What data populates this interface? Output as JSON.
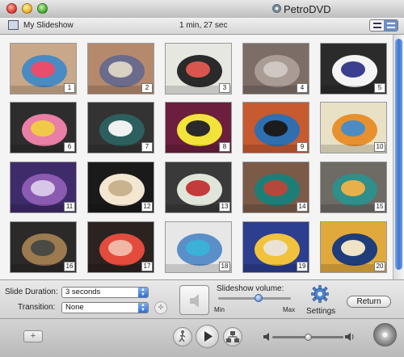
{
  "window": {
    "app_title": "PetroDVD"
  },
  "toolbar": {
    "slideshow_title": "My Slideshow",
    "duration": "1 min, 27 sec"
  },
  "thumbnails": [
    {
      "number": "1",
      "colors": [
        "#c9a88a",
        "#4a8bc1",
        "#e94d6b"
      ]
    },
    {
      "number": "2",
      "colors": [
        "#b58a6c",
        "#6b6b8c",
        "#d8d1c4"
      ]
    },
    {
      "number": "3",
      "colors": [
        "#e7e7e2",
        "#2a2a2a",
        "#d9564f"
      ]
    },
    {
      "number": "4",
      "colors": [
        "#7c6d66",
        "#a99c94",
        "#cfc7c2"
      ]
    },
    {
      "number": "5",
      "colors": [
        "#2b2b2b",
        "#f4f4f4",
        "#3b3f8e"
      ]
    },
    {
      "number": "6",
      "colors": [
        "#2d2d2d",
        "#e97ea6",
        "#f1c948"
      ]
    },
    {
      "number": "7",
      "colors": [
        "#333333",
        "#2d5f5f",
        "#f1f1f1"
      ]
    },
    {
      "number": "8",
      "colors": [
        "#6b1e3e",
        "#f2e33a",
        "#2a2a2a"
      ]
    },
    {
      "number": "9",
      "colors": [
        "#c75a2f",
        "#2f6fb0",
        "#1c1c1c"
      ]
    },
    {
      "number": "10",
      "colors": [
        "#e9e1c6",
        "#e8902d",
        "#4c8cc3"
      ]
    },
    {
      "number": "11",
      "colors": [
        "#3e2b6a",
        "#8a5bb1",
        "#d8c6e8"
      ]
    },
    {
      "number": "12",
      "colors": [
        "#1a1a1a",
        "#f3e7d2",
        "#c9b28e"
      ]
    },
    {
      "number": "13",
      "colors": [
        "#3a3a3a",
        "#dfe6d9",
        "#c33b3b"
      ]
    },
    {
      "number": "14",
      "colors": [
        "#7b5a47",
        "#1c7f77",
        "#b4483b"
      ]
    },
    {
      "number": "15",
      "colors": [
        "#6e6a64",
        "#2f8f8a",
        "#e8b04a"
      ]
    },
    {
      "number": "16",
      "colors": [
        "#2c2a28",
        "#9b7a4f",
        "#4a4a45"
      ]
    },
    {
      "number": "17",
      "colors": [
        "#2b2320",
        "#e34b3d",
        "#f1b6a6"
      ]
    },
    {
      "number": "18",
      "colors": [
        "#e7e7e7",
        "#5a8fc9",
        "#3ab1d6"
      ]
    },
    {
      "number": "19",
      "colors": [
        "#2c3e8f",
        "#f2c23c",
        "#e8e3d4"
      ]
    },
    {
      "number": "20",
      "colors": [
        "#e1a93c",
        "#1f3d7a",
        "#efe3c8"
      ]
    }
  ],
  "controls": {
    "slide_duration_label": "Slide Duration:",
    "slide_duration_value": "3 seconds",
    "transition_label": "Transition:",
    "transition_value": "None",
    "volume_label": "Slideshow volume:",
    "volume_min": "Min",
    "volume_max": "Max",
    "volume_level": 0.55,
    "settings_label": "Settings",
    "return_label": "Return"
  },
  "bottom": {
    "add_label": "+",
    "playback_volume_level": 0.5
  },
  "icons": {
    "app": "dvd-disc-icon",
    "slideshow": "slideshow-icon",
    "speaker": "speaker-icon",
    "settings": "gear-icon",
    "motion": "walking-figure-icon",
    "play": "play-icon",
    "map": "map-icon",
    "burn": "burn-disc-icon"
  }
}
